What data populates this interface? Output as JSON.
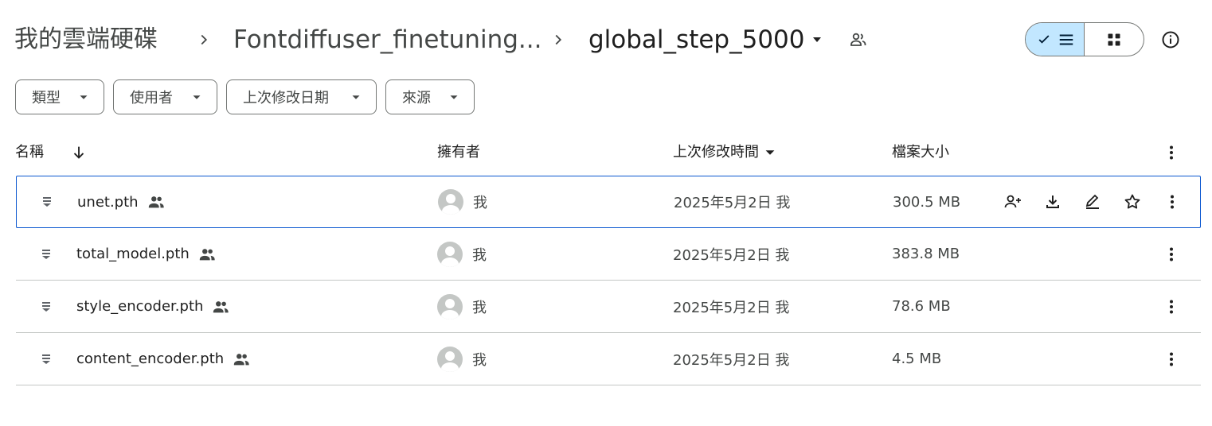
{
  "breadcrumb": {
    "root": "我的雲端硬碟",
    "parent": "Fontdiffuser_finetuning...",
    "current": "global_step_5000"
  },
  "filters": [
    {
      "label": "類型"
    },
    {
      "label": "使用者"
    },
    {
      "label": "上次修改日期"
    },
    {
      "label": "來源"
    }
  ],
  "columns": {
    "name": "名稱",
    "owner": "擁有者",
    "modified": "上次修改時間",
    "size": "檔案大小"
  },
  "files": [
    {
      "name": "unet.pth",
      "owner": "我",
      "modified": "2025年5月2日 我",
      "size": "300.5 MB",
      "shared": true,
      "selected": true
    },
    {
      "name": "total_model.pth",
      "owner": "我",
      "modified": "2025年5月2日 我",
      "size": "383.8 MB",
      "shared": true,
      "selected": false
    },
    {
      "name": "style_encoder.pth",
      "owner": "我",
      "modified": "2025年5月2日 我",
      "size": "78.6 MB",
      "shared": true,
      "selected": false
    },
    {
      "name": "content_encoder.pth",
      "owner": "我",
      "modified": "2025年5月2日 我",
      "size": "4.5 MB",
      "shared": true,
      "selected": false
    }
  ],
  "colors": {
    "accent": "#0b57d0",
    "toggle_active_bg": "#c2e7ff",
    "divider": "#c4c7c5"
  }
}
